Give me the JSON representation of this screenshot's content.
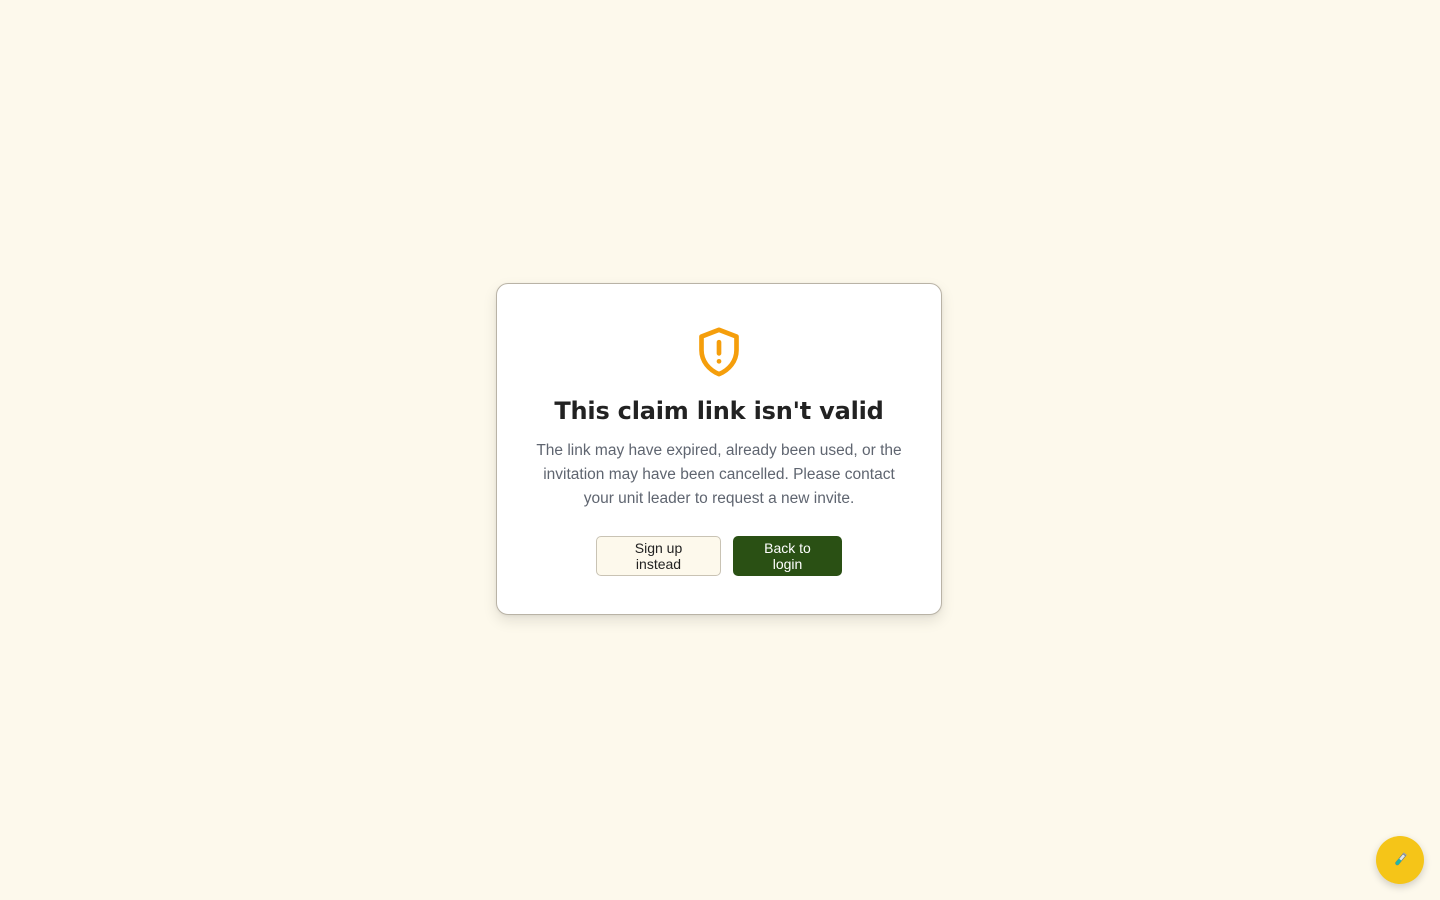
{
  "card": {
    "title": "This claim link isn't valid",
    "message": "The link may have expired, already been used, or the invitation may have been cancelled. Please contact your unit leader to request a new invite.",
    "icon": "shield-alert-icon"
  },
  "actions": {
    "secondary_label": "Sign up instead",
    "primary_label": "Back to login"
  },
  "fab": {
    "icon": "test-tube-icon"
  },
  "colors": {
    "background": "#fdf9ec",
    "warning": "#f59e0b",
    "primary": "#2a5014",
    "fab": "#f5c518"
  }
}
